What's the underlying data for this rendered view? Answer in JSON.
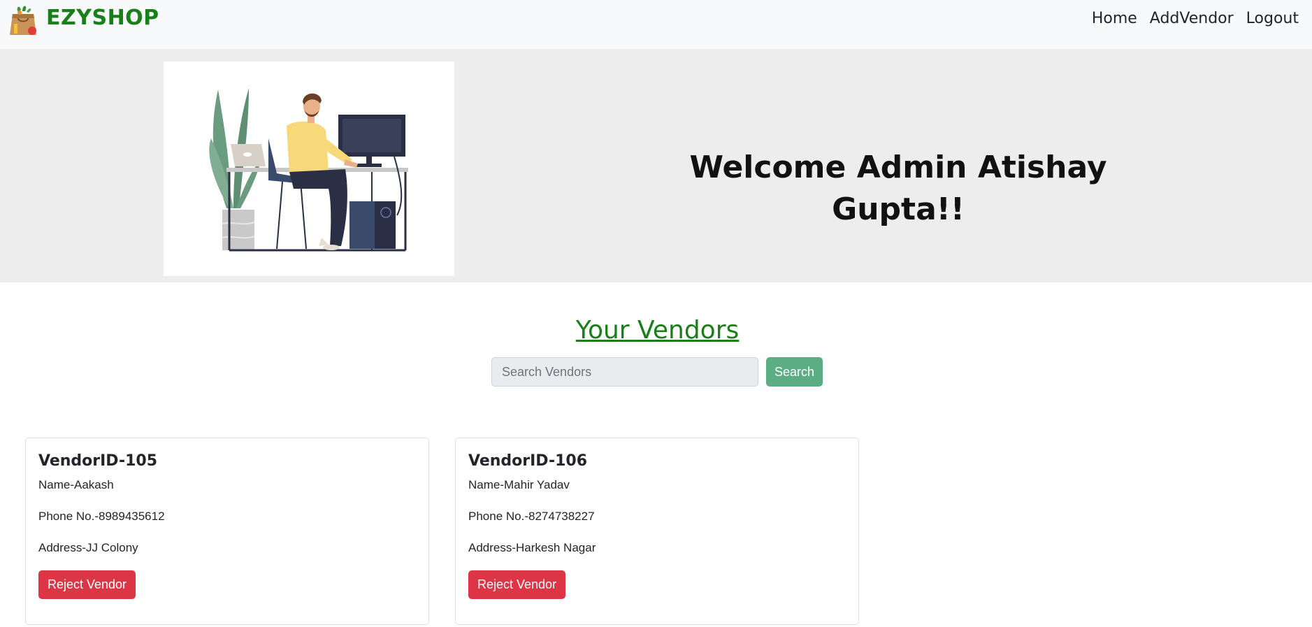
{
  "navbar": {
    "brand": "EZYSHOP",
    "links": [
      "Home",
      "AddVendor",
      "Logout"
    ]
  },
  "hero": {
    "title": "Welcome Admin Atishay Gupta!!"
  },
  "vendors_section": {
    "title": "Your Vendors",
    "search_placeholder": "Search Vendors",
    "search_button": "Search"
  },
  "vendors": [
    {
      "id": "VendorID-105",
      "name": "Name-Aakash",
      "phone": "Phone No.-8989435612",
      "address": "Address-JJ Colony",
      "action": "Reject Vendor"
    },
    {
      "id": "VendorID-106",
      "name": "Name-Mahir Yadav",
      "phone": "Phone No.-8274738227",
      "address": "Address-Harkesh Nagar",
      "action": "Reject Vendor"
    }
  ],
  "colors": {
    "brand": "#198019",
    "search_button": "#5cad84",
    "reject_button": "#dc3545",
    "hero_bg": "#ededed",
    "navbar_bg": "#f8f9fa"
  },
  "icons": {
    "logo": "grocery-bag-icon",
    "hero_illustration": "person-at-computer-illustration"
  }
}
